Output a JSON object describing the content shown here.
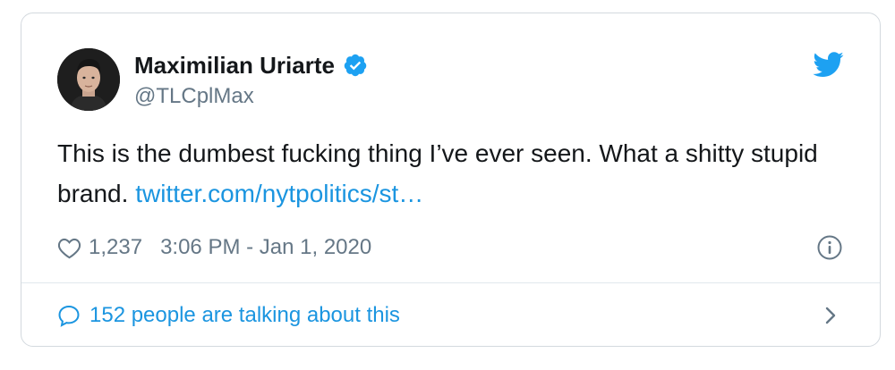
{
  "author": {
    "display_name": "Maximilian Uriarte",
    "handle": "@TLCplMax",
    "verified": true,
    "avatar_icon": "profile-photo"
  },
  "tweet": {
    "text": "This is the dumbest fucking thing I’ve ever seen. What a shitty stupid brand.",
    "link_text": "twitter.com/nytpolitics/st…"
  },
  "meta": {
    "like_count": "1,237",
    "timestamp": "3:06 PM - Jan 1, 2020"
  },
  "footer": {
    "conversation_text": "152 people are talking about this"
  },
  "icons": {
    "brand": "twitter-bird-icon",
    "verified": "verified-badge-icon",
    "like": "heart-icon",
    "info": "info-icon",
    "reply": "speech-bubble-icon",
    "chevron": "chevron-right-icon"
  },
  "colors": {
    "brand_blue": "#1da1f2",
    "link_blue": "#1b95e0",
    "text_primary": "#14171a",
    "text_secondary": "#657786",
    "border": "#d3d9de"
  }
}
